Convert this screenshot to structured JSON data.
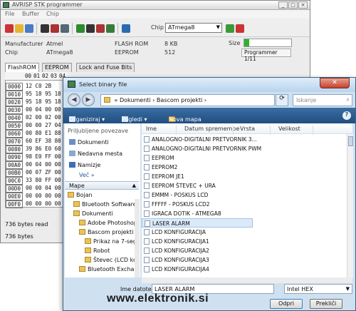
{
  "main_window": {
    "title": "AVRISP STK programmer",
    "menu": [
      "File",
      "Buffer",
      "Chip"
    ],
    "chip_label": "Chip",
    "chip_value": "ATmega8",
    "manufacturer_label": "Manufacturer",
    "manufacturer_value": "Atmel",
    "chip_row_label": "Chip",
    "chip_row_value": "ATmega8",
    "flash_label": "FLASH ROM",
    "flash_value": "8 KB",
    "eeprom_label": "EEPROM",
    "eeprom_value": "512",
    "size_label": "Size",
    "size_fill_percent": 11,
    "programmer_box": "Programmer 1/11",
    "tabs": [
      "FlashROM",
      "EEPROM",
      "Lock and Fuse Bits"
    ],
    "hex_header": [
      "00",
      "01",
      "02",
      "03",
      "04"
    ],
    "hex_rows": [
      {
        "addr": "0000",
        "bytes": "12 C0 2B"
      },
      {
        "addr": "0010",
        "bytes": "95 18 95 18"
      },
      {
        "addr": "0020",
        "bytes": "95 18 95 18"
      },
      {
        "addr": "0030",
        "bytes": "00 04 00 00"
      },
      {
        "addr": "0040",
        "bytes": "02 00 02 00"
      },
      {
        "addr": "0050",
        "bytes": "00 00 27 04"
      },
      {
        "addr": "0060",
        "bytes": "00 80 E1 88"
      },
      {
        "addr": "0070",
        "bytes": "60 EF 38 80"
      },
      {
        "addr": "0080",
        "bytes": "39 86 E0 60"
      },
      {
        "addr": "0090",
        "bytes": "98 E0 FF 00"
      },
      {
        "addr": "00A0",
        "bytes": "00 04 00 00"
      },
      {
        "addr": "00B0",
        "bytes": "00 07 ZF 00"
      },
      {
        "addr": "00C0",
        "bytes": "33 80 FF 00"
      },
      {
        "addr": "00D0",
        "bytes": "00 00 04 00"
      },
      {
        "addr": "00E0",
        "bytes": "00 00 00 00"
      },
      {
        "addr": "00F0",
        "bytes": "00 00 00 00"
      }
    ],
    "status_bytes": "736 bytes read",
    "status_bottom": "736 bytes"
  },
  "dialog": {
    "title": "Select binary file",
    "address_path": "« Dokumenti › Bascom projekti ›",
    "search_placeholder": "Iskanje",
    "cmd_organize": "Organiziraj ▾",
    "cmd_views": "Pogledi ▾",
    "cmd_new_folder": "Nova mapa",
    "help_icon_label": "?",
    "favorites_header": "Priljubljene povezave",
    "favorites": [
      "Dokumenti",
      "Nedavna mesta",
      "Namizje",
      "Več »"
    ],
    "folders_header": "Mape",
    "tree": [
      {
        "label": "Bojan",
        "indent": 0
      },
      {
        "label": "Bluetooth Software",
        "indent": 1
      },
      {
        "label": "Dokumenti",
        "indent": 1
      },
      {
        "label": "Adobe Photoshop",
        "indent": 2
      },
      {
        "label": "Bascom projekti",
        "indent": 2
      },
      {
        "label": "Prikaz na 7-seg",
        "indent": 3
      },
      {
        "label": "Robot",
        "indent": 3
      },
      {
        "label": "Števec (LCD kon",
        "indent": 3
      },
      {
        "label": "Bluetooth Exchange",
        "indent": 2
      }
    ],
    "columns": [
      "Ime",
      "Datum spremembe",
      "Vrsta",
      "Velikost"
    ],
    "files": [
      {
        "name": "ANALOGNO-DIGITALNI PRETVORNIK 3...",
        "selected": false
      },
      {
        "name": "ANALOGNO-DIGITALNI PRETVORNIK PWM",
        "selected": false
      },
      {
        "name": "EEPROM",
        "selected": false
      },
      {
        "name": "EEPROM2",
        "selected": false
      },
      {
        "name": "EEPROM JE1",
        "selected": false
      },
      {
        "name": "EEPROM ŠTEVEC + URA",
        "selected": false
      },
      {
        "name": "EMMM - POSKUS LCD",
        "selected": false
      },
      {
        "name": "FFFFF - POSKUS LCD2",
        "selected": false
      },
      {
        "name": "IGRACA DOTIK - ATMEGA8",
        "selected": false
      },
      {
        "name": "LASER ALARM",
        "selected": true
      },
      {
        "name": "LCD KONFIGURACIJA",
        "selected": false
      },
      {
        "name": "LCD KONFIGURACIJA1",
        "selected": false
      },
      {
        "name": "LCD KONFIGURACIJA2",
        "selected": false
      },
      {
        "name": "LCD KONFIGURACIJA3",
        "selected": false
      },
      {
        "name": "LCD KONFIGURACIJA4",
        "selected": false
      }
    ],
    "filename_label": "Ime datoteke:",
    "filename_value": "LASER ALARM",
    "filetype_value": "Intel HEX",
    "open_button": "Odpri",
    "cancel_button": "Prekliči"
  },
  "watermark": "www.elektronik.si",
  "colors": {
    "dialog_bg": "#cfe1f1",
    "cmdbar": "#2b5b8f",
    "progress": "#2db22d",
    "selected_row": "#dceaf8"
  }
}
